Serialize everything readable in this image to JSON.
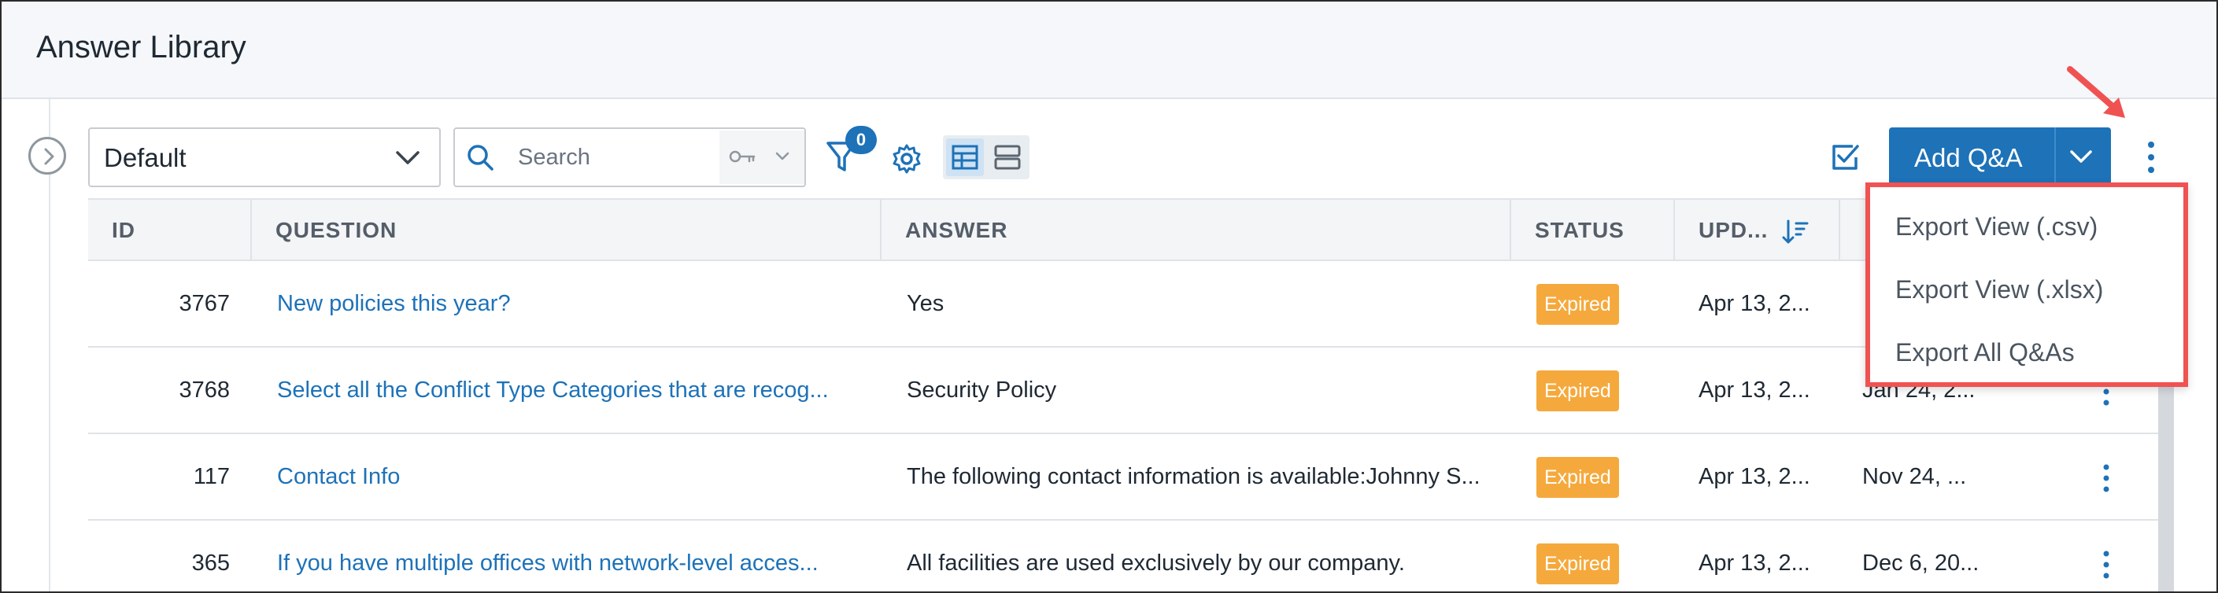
{
  "page": {
    "title": "Answer Library"
  },
  "toolbar": {
    "view_select_value": "Default",
    "search_placeholder": "Search",
    "filter_count": "0",
    "add_button_label": "Add Q&A"
  },
  "table": {
    "headers": [
      "ID",
      "QUESTION",
      "ANSWER",
      "STATUS",
      "UPD..."
    ],
    "rows": [
      {
        "id": "3767",
        "question": "New policies this year?",
        "answer": "Yes",
        "status": "Expired",
        "updated": "Apr 13, 2...",
        "second_date": ""
      },
      {
        "id": "3768",
        "question": "Select all the Conflict Type Categories that are recog...",
        "answer": "Security Policy",
        "status": "Expired",
        "updated": "Apr 13, 2...",
        "second_date": "Jan 24, 2..."
      },
      {
        "id": "117",
        "question": "Contact Info",
        "answer": "The following contact information is available:Johnny S...",
        "status": "Expired",
        "updated": "Apr 13, 2...",
        "second_date": "Nov 24, ..."
      },
      {
        "id": "365",
        "question": "If you have multiple offices with network-level acces...",
        "answer": "All facilities are used exclusively by our company.",
        "status": "Expired",
        "updated": "Apr 13, 2...",
        "second_date": "Dec 6, 20..."
      }
    ]
  },
  "export_menu": {
    "items": [
      "Export View (.csv)",
      "Export View (.xlsx)",
      "Export All Q&As"
    ]
  },
  "colors": {
    "accent": "#1d72b8",
    "status_expired": "#f5a93c",
    "highlight_annotation": "#f05252"
  },
  "icons": [
    "chevron-right-icon",
    "chevron-down-icon",
    "search-icon",
    "key-icon",
    "filter-icon",
    "gear-icon",
    "table-view-icon",
    "list-view-icon",
    "checkbox-icon",
    "kebab-icon",
    "sort-icon",
    "arrow-annotation-icon"
  ]
}
